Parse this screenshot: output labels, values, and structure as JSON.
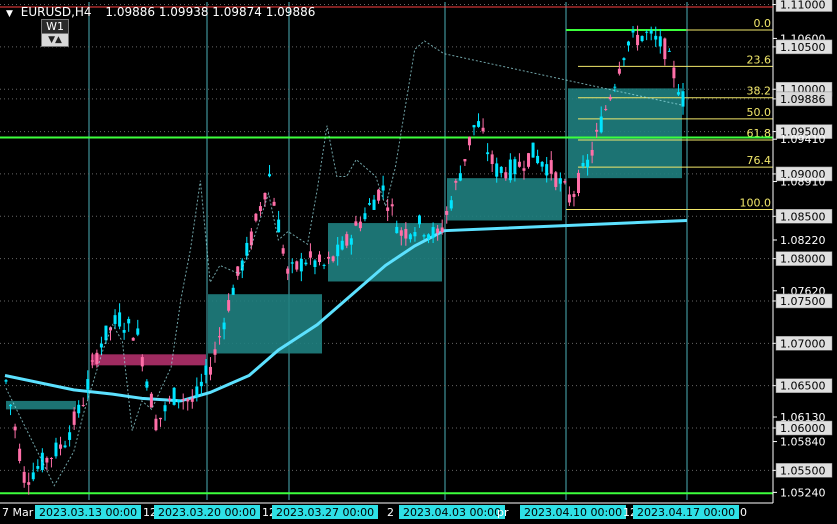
{
  "header": {
    "symbol": "EURUSD,H4",
    "ohlc": "1.09886 1.09938 1.09874 1.09886",
    "period_button": "W1",
    "arrows": "▼▲"
  },
  "colors": {
    "background": "#000000",
    "bull": "#00e5ff",
    "bear": "#ff6fa8",
    "ma": "#5ce1ff",
    "fib": "#f2e86b",
    "level": "#3cff3c",
    "demand_zone": "#1f7f7f",
    "supply_zone": "#b0306a",
    "grid_v": "#5ad0d8",
    "price_tag_bg": "#e0e0e0",
    "date_tag_bg": "#2ee0e6",
    "current_price": "#ff4040"
  },
  "price_axis": {
    "labels": [
      "1.11000",
      "1.10600",
      "1.10500",
      "1.10000",
      "1.09886",
      "1.09500",
      "1.09410",
      "1.09000",
      "1.08910",
      "1.08500",
      "1.08220",
      "1.08000",
      "1.07620",
      "1.07500",
      "1.07000",
      "1.06500",
      "1.06130",
      "1.06000",
      "1.05840",
      "1.05500",
      "1.05240"
    ],
    "boxed": [
      "1.11000",
      "1.10500",
      "1.10000",
      "1.09886",
      "1.09500",
      "1.09000",
      "1.08500",
      "1.08000",
      "1.07500",
      "1.07000",
      "1.06500",
      "1.06000",
      "1.05500"
    ],
    "current": "1.09886"
  },
  "time_axis": {
    "left_fragment": "7 Mar",
    "dates": [
      "2023.03.13 00:00",
      "2023.03.20 00:00",
      "2023.03.27 00:00",
      "2023.04.03 00:00",
      "2023.04.10 00:00",
      "2023.04.17 00:00"
    ],
    "fragments": [
      "12",
      "12",
      "2",
      "pr",
      "12",
      "0"
    ]
  },
  "fibonacci": [
    {
      "label": "0.0",
      "price": 1.107
    },
    {
      "label": "23.6",
      "price": 1.1027
    },
    {
      "label": "38.2",
      "price": 1.099
    },
    {
      "label": "50.0",
      "price": 1.0965
    },
    {
      "label": "61.8",
      "price": 1.094
    },
    {
      "label": "76.4",
      "price": 1.0908
    },
    {
      "label": "100.0",
      "price": 1.0858
    }
  ],
  "chart_data": {
    "type": "candlestick",
    "symbol": "EURUSD",
    "timeframe": "H4",
    "ylim": [
      1.0515,
      1.1103
    ],
    "x_start": "2023-03-07",
    "moving_average_points": [
      [
        "2023-03-07",
        1.0662
      ],
      [
        "2023-03-10",
        1.0645
      ],
      [
        "2023-03-14",
        1.064
      ],
      [
        "2023-03-17",
        1.0635
      ],
      [
        "2023-03-21",
        1.0632
      ],
      [
        "2023-03-24",
        1.0642
      ],
      [
        "2023-03-28",
        1.0662
      ],
      [
        "2023-03-31",
        1.0692
      ],
      [
        "2023-04-04",
        1.0722
      ],
      [
        "2023-04-07",
        1.0752
      ],
      [
        "2023-04-11",
        1.0792
      ],
      [
        "2023-04-14",
        1.0815
      ],
      [
        "2023-04-17",
        1.0833
      ],
      [
        "2023-04-18",
        1.0845
      ]
    ],
    "price_path": [
      [
        "2023-03-07",
        1.0655
      ],
      [
        "2023-03-08",
        1.054
      ],
      [
        "2023-03-09",
        1.056
      ],
      [
        "2023-03-10",
        1.058
      ],
      [
        "2023-03-11",
        1.0625
      ],
      [
        "2023-03-13",
        1.07
      ],
      [
        "2023-03-14",
        1.073
      ],
      [
        "2023-03-15",
        1.071
      ],
      [
        "2023-03-16",
        1.0605
      ],
      [
        "2023-03-17",
        1.064
      ],
      [
        "2023-03-18",
        1.063
      ],
      [
        "2023-03-20",
        1.068
      ],
      [
        "2023-03-21",
        1.076
      ],
      [
        "2023-03-22",
        1.082
      ],
      [
        "2023-03-23",
        1.09
      ],
      [
        "2023-03-24",
        1.078
      ],
      [
        "2023-03-25",
        1.08
      ],
      [
        "2023-03-27",
        1.079
      ],
      [
        "2023-03-28",
        1.0815
      ],
      [
        "2023-03-29",
        1.085
      ],
      [
        "2023-03-30",
        1.0885
      ],
      [
        "2023-03-31",
        1.083
      ],
      [
        "2023-04-01",
        1.084
      ],
      [
        "2023-04-03",
        1.0825
      ],
      [
        "2023-04-04",
        1.089
      ],
      [
        "2023-04-05",
        1.0965
      ],
      [
        "2023-04-06",
        1.0905
      ],
      [
        "2023-04-07",
        1.0905
      ],
      [
        "2023-04-08",
        1.0925
      ],
      [
        "2023-04-10",
        1.0905
      ],
      [
        "2023-04-11",
        1.087
      ],
      [
        "2023-04-12",
        1.0915
      ],
      [
        "2023-04-13",
        1.0985
      ],
      [
        "2023-04-14",
        1.1055
      ],
      [
        "2023-04-15",
        1.1065
      ],
      [
        "2023-04-17",
        1.105
      ],
      [
        "2023-04-18",
        1.0989
      ]
    ],
    "horizontal_levels": [
      1.0943,
      1.0523
    ]
  }
}
